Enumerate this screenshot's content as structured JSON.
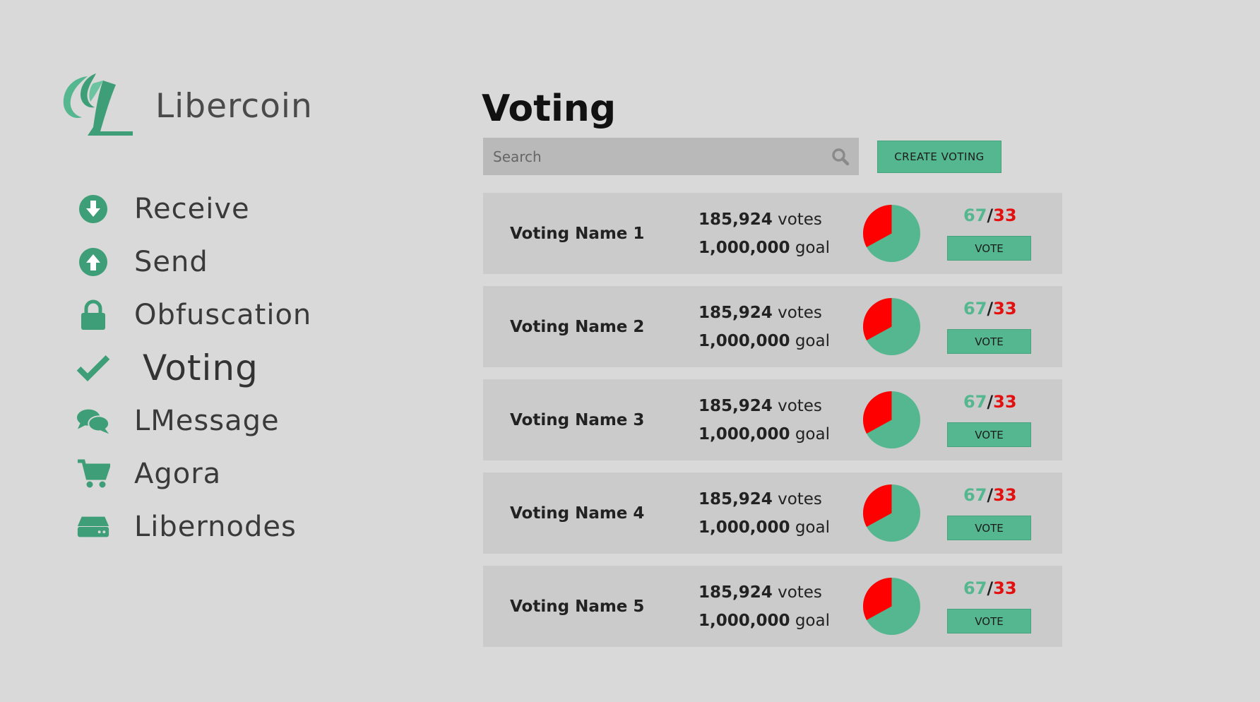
{
  "brand": {
    "name": "Libercoin",
    "accent": "#55b78f"
  },
  "nav": [
    {
      "label": "Receive",
      "icon": "download-circle-icon"
    },
    {
      "label": "Send",
      "icon": "upload-circle-icon"
    },
    {
      "label": "Obfuscation",
      "icon": "lock-icon"
    },
    {
      "label": "Voting",
      "icon": "check-icon",
      "active": true
    },
    {
      "label": "LMessage",
      "icon": "chat-bubbles-icon"
    },
    {
      "label": "Agora",
      "icon": "shopping-cart-icon"
    },
    {
      "label": "Libernodes",
      "icon": "server-drive-icon"
    }
  ],
  "page": {
    "title": "Voting",
    "search": {
      "placeholder": "Search",
      "value": ""
    },
    "create_label": "CREATE VOTING"
  },
  "votings": [
    {
      "name": "Voting Name 1",
      "votes": "185,924",
      "votes_unit": "votes",
      "goal": "1,000,000",
      "goal_unit": "goal",
      "yes": 67,
      "no": 33,
      "sep": "/",
      "button": "VOTE"
    },
    {
      "name": "Voting Name 2",
      "votes": "185,924",
      "votes_unit": "votes",
      "goal": "1,000,000",
      "goal_unit": "goal",
      "yes": 67,
      "no": 33,
      "sep": "/",
      "button": "VOTE"
    },
    {
      "name": "Voting Name 3",
      "votes": "185,924",
      "votes_unit": "votes",
      "goal": "1,000,000",
      "goal_unit": "goal",
      "yes": 67,
      "no": 33,
      "sep": "/",
      "button": "VOTE"
    },
    {
      "name": "Voting Name 4",
      "votes": "185,924",
      "votes_unit": "votes",
      "goal": "1,000,000",
      "goal_unit": "goal",
      "yes": 67,
      "no": 33,
      "sep": "/",
      "button": "VOTE"
    },
    {
      "name": "Voting Name 5",
      "votes": "185,924",
      "votes_unit": "votes",
      "goal": "1,000,000",
      "goal_unit": "goal",
      "yes": 67,
      "no": 33,
      "sep": "/",
      "button": "VOTE"
    }
  ],
  "colors": {
    "yes": "#55b78f",
    "no": "#ff0000"
  }
}
